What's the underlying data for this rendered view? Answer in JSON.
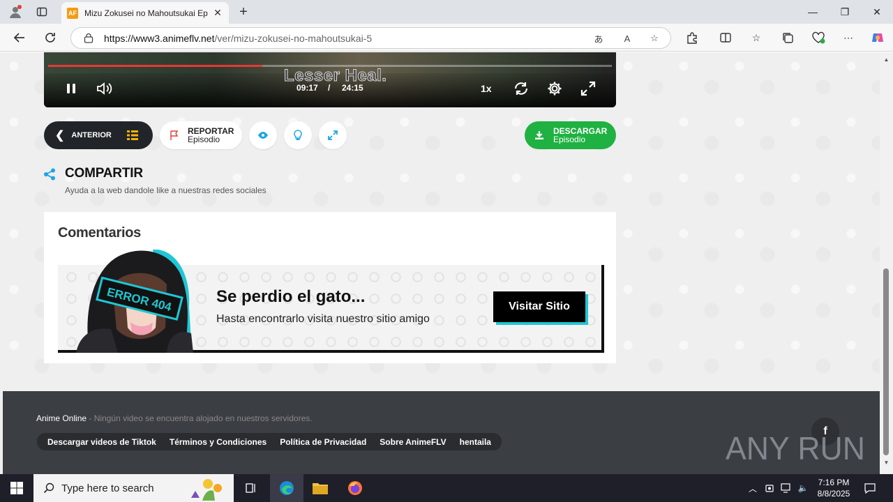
{
  "browser": {
    "tab_title": "Mizu Zokusei no Mahoutsukai Ep",
    "favicon_text": "AF",
    "url_host": "https://www3.animeflv.net",
    "url_path": "/ver/mizu-zokusei-no-mahoutsukai-5"
  },
  "player": {
    "subtitle": "Lesser Heal.",
    "current_time": "09:17",
    "separator": "/",
    "duration": "24:15",
    "speed": "1x",
    "progress_fraction": 0.38
  },
  "actions": {
    "anterior_label": "ANTERIOR",
    "report_top": "REPORTAR",
    "report_bottom": "Episodio",
    "download_top": "DESCARGAR",
    "download_bottom": "Episodio"
  },
  "share": {
    "title": "COMPARTIR",
    "subtitle": "Ayuda a la web dandole like a nuestras redes sociales"
  },
  "comments": {
    "title": "Comentarios",
    "banner_badge": "ERROR 404",
    "banner_title": "Se perdio el gato...",
    "banner_sub": "Hasta encontrarlo visita nuestro sitio amigo",
    "banner_button": "Visitar Sitio"
  },
  "footer": {
    "brand": "Anime Online",
    "notice": " - Ningún video se encuentra alojado en nuestros servidores.",
    "links": [
      "Descargar videos de Tiktok",
      "Términos y Condiciones",
      "Política de Privacidad",
      "Sobre AnimeFLV",
      "hentaila"
    ],
    "facebook": "f",
    "watermark": "ANY RUN"
  },
  "taskbar": {
    "search_placeholder": "Type here to search",
    "time": "7:16 PM",
    "date": "8/8/2025"
  },
  "colors": {
    "accent_green": "#1fb141",
    "accent_cyan": "#1ec7d4",
    "progress_red": "#e53935"
  }
}
